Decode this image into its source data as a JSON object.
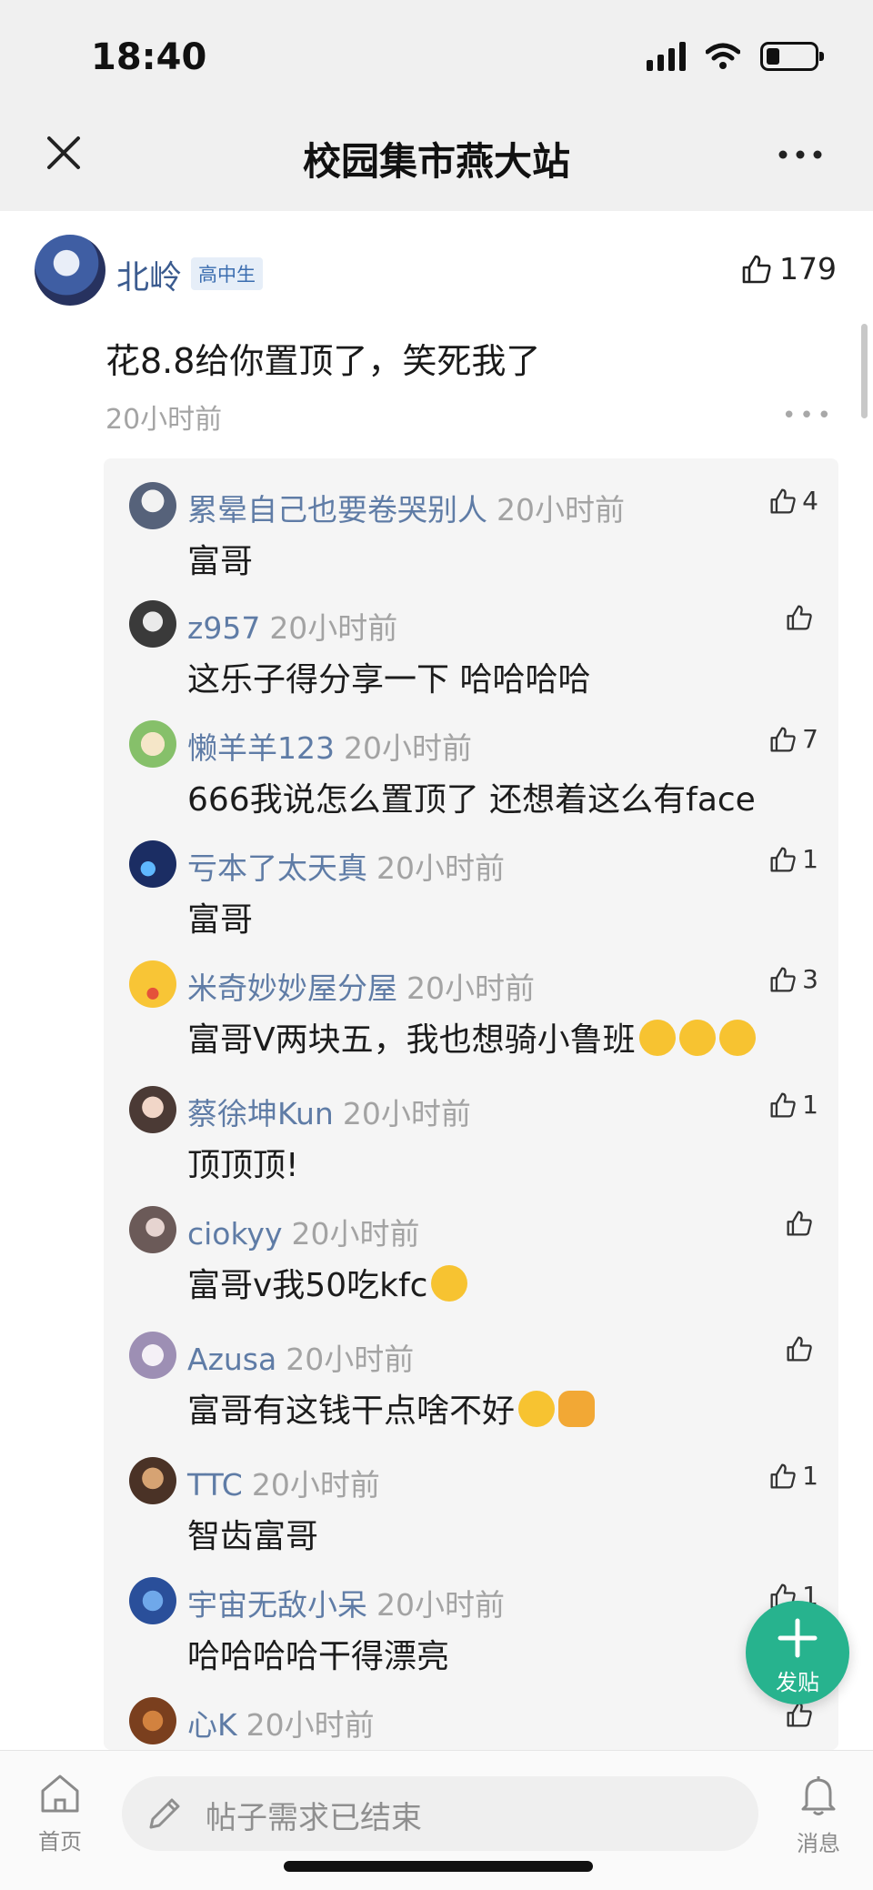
{
  "status_bar": {
    "time": "18:40"
  },
  "header": {
    "title": "校园集市燕大站"
  },
  "main_comment": {
    "author": "北岭",
    "badge": "高中生",
    "likes": "179",
    "text": "花8.8给你置顶了，笑死我了",
    "time": "20小时前"
  },
  "replies": [
    {
      "name": "累晕自己也要卷哭别人",
      "time": "20小时前",
      "text": "富哥",
      "likes": "4"
    },
    {
      "name": "z957",
      "time": "20小时前",
      "text": "这乐子得分享一下 哈哈哈哈",
      "likes": ""
    },
    {
      "name": "懒羊羊123",
      "time": "20小时前",
      "text": "666我说怎么置顶了 还想着这么有face",
      "likes": "7"
    },
    {
      "name": "亏本了太天真",
      "time": "20小时前",
      "text": "富哥",
      "likes": "1"
    },
    {
      "name": "米奇妙妙屋分屋",
      "time": "20小时前",
      "text": "富哥V两块五，我也想骑小鲁班",
      "likes": "3"
    },
    {
      "name": "蔡徐坤Kun",
      "time": "20小时前",
      "text": "顶顶顶!",
      "likes": "1"
    },
    {
      "name": "ciokyy",
      "time": "20小时前",
      "text": "富哥v我50吃kfc",
      "likes": ""
    },
    {
      "name": "Azusa",
      "time": "20小时前",
      "text": "富哥有这钱干点啥不好",
      "likes": ""
    },
    {
      "name": "TTC",
      "time": "20小时前",
      "text": "智齿富哥",
      "likes": "1"
    },
    {
      "name": "宇宙无敌小呆",
      "time": "20小时前",
      "text": "哈哈哈哈干得漂亮",
      "likes": "1"
    },
    {
      "name": "心K",
      "time": "20小时前",
      "text": "",
      "likes": ""
    }
  ],
  "fab": {
    "label": "发贴"
  },
  "bottom_bar": {
    "home_label": "首页",
    "input_placeholder": "帖子需求已结束",
    "messages_label": "消息"
  },
  "colors": {
    "accent": "#27b38e",
    "name_link": "#5f7ca6",
    "reply_bg": "#f5f5f5"
  },
  "icons": [
    "close-icon",
    "more-icon",
    "thumbs-up-icon",
    "plus-icon",
    "home-icon",
    "pencil-icon",
    "bell-icon",
    "wifi-icon",
    "signal-icon",
    "battery-icon"
  ]
}
